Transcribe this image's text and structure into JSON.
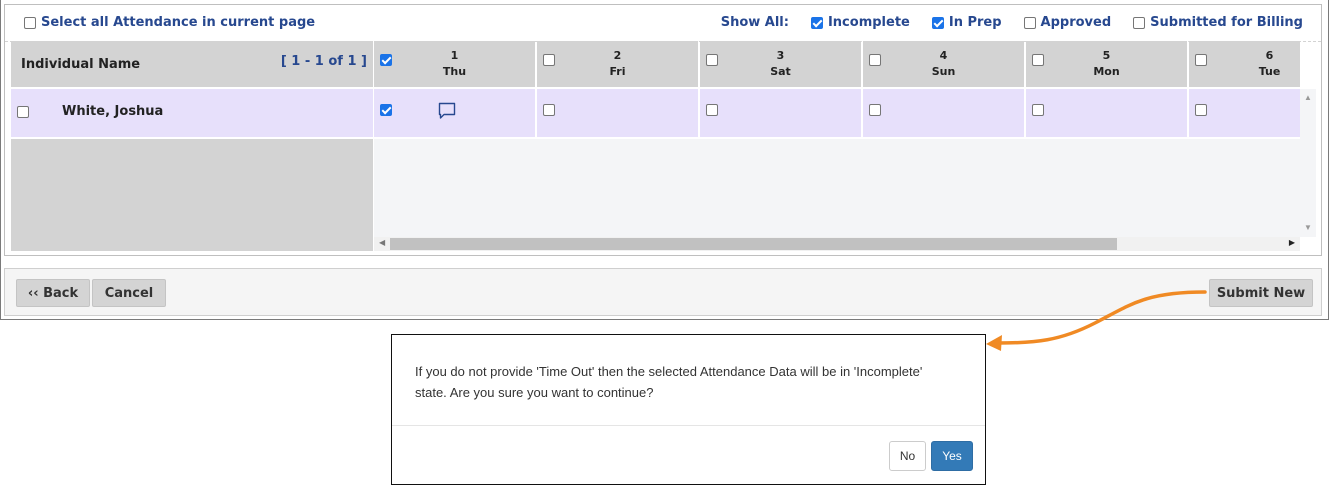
{
  "toolbar": {
    "select_all_label": "Select all Attendance in current page",
    "show_all_label": "Show All:",
    "filters": [
      {
        "label": "Incomplete",
        "checked": true
      },
      {
        "label": "In Prep",
        "checked": true
      },
      {
        "label": "Approved",
        "checked": false
      },
      {
        "label": "Submitted for Billing",
        "checked": false
      }
    ]
  },
  "grid": {
    "name_header": "Individual Name",
    "range_label": "[ 1 - 1 of 1 ]",
    "days": [
      {
        "num": "1",
        "dow": "Thu",
        "header_checked": true
      },
      {
        "num": "2",
        "dow": "Fri",
        "header_checked": false
      },
      {
        "num": "3",
        "dow": "Sat",
        "header_checked": false
      },
      {
        "num": "4",
        "dow": "Sun",
        "header_checked": false
      },
      {
        "num": "5",
        "dow": "Mon",
        "header_checked": false
      },
      {
        "num": "6",
        "dow": "Tue",
        "header_checked": false
      }
    ],
    "rows": [
      {
        "name": "White, Joshua",
        "checked": false,
        "cells": [
          {
            "checked": true,
            "comment_icon": "comment-icon"
          },
          {
            "checked": false
          },
          {
            "checked": false
          },
          {
            "checked": false
          },
          {
            "checked": false
          },
          {
            "checked": false
          }
        ]
      }
    ]
  },
  "buttons": {
    "back": "‹‹ Back",
    "cancel": "Cancel",
    "submit_new": "Submit New"
  },
  "dialog": {
    "message_line1": "If you do not provide 'Time Out' then the selected Attendance Data will be in 'Incomplete'",
    "message_line2": "state. Are you sure you want to continue?",
    "no": "No",
    "yes": "Yes"
  },
  "colors": {
    "accent_link": "#27488f",
    "row_highlight": "#e7e0fb",
    "header_gray": "#d3d3d3",
    "annotation_arrow": "#f08a24",
    "yes_button": "#337ab7"
  }
}
